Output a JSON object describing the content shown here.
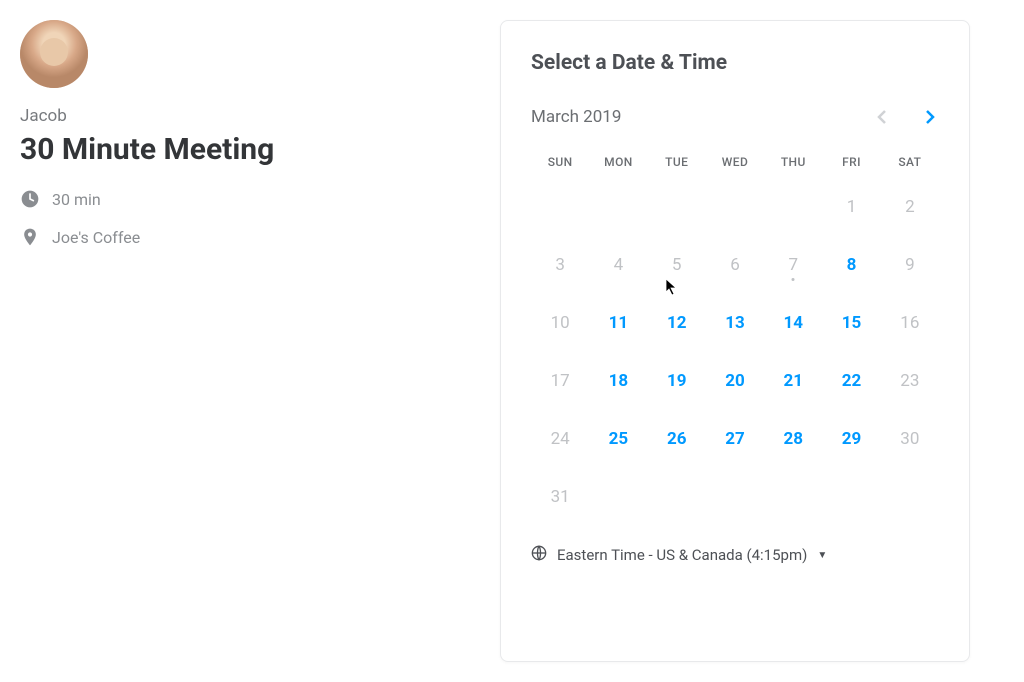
{
  "host": {
    "name": "Jacob"
  },
  "meeting": {
    "title": "30 Minute Meeting",
    "duration": "30 min",
    "location": "Joe's Coffee"
  },
  "calendar": {
    "heading": "Select a Date & Time",
    "month_label": "March 2019",
    "weekdays": [
      "SUN",
      "MON",
      "TUE",
      "WED",
      "THU",
      "FRI",
      "SAT"
    ],
    "days": [
      {
        "n": "",
        "state": "empty"
      },
      {
        "n": "",
        "state": "empty"
      },
      {
        "n": "",
        "state": "empty"
      },
      {
        "n": "",
        "state": "empty"
      },
      {
        "n": "",
        "state": "empty"
      },
      {
        "n": "1",
        "state": "disabled"
      },
      {
        "n": "2",
        "state": "disabled"
      },
      {
        "n": "3",
        "state": "disabled"
      },
      {
        "n": "4",
        "state": "disabled"
      },
      {
        "n": "5",
        "state": "disabled"
      },
      {
        "n": "6",
        "state": "disabled"
      },
      {
        "n": "7",
        "state": "disabled",
        "today": true
      },
      {
        "n": "8",
        "state": "available"
      },
      {
        "n": "9",
        "state": "disabled"
      },
      {
        "n": "10",
        "state": "disabled"
      },
      {
        "n": "11",
        "state": "available"
      },
      {
        "n": "12",
        "state": "available"
      },
      {
        "n": "13",
        "state": "available"
      },
      {
        "n": "14",
        "state": "available"
      },
      {
        "n": "15",
        "state": "available"
      },
      {
        "n": "16",
        "state": "disabled"
      },
      {
        "n": "17",
        "state": "disabled"
      },
      {
        "n": "18",
        "state": "available"
      },
      {
        "n": "19",
        "state": "available"
      },
      {
        "n": "20",
        "state": "available"
      },
      {
        "n": "21",
        "state": "available"
      },
      {
        "n": "22",
        "state": "available"
      },
      {
        "n": "23",
        "state": "disabled"
      },
      {
        "n": "24",
        "state": "disabled"
      },
      {
        "n": "25",
        "state": "available"
      },
      {
        "n": "26",
        "state": "available"
      },
      {
        "n": "27",
        "state": "available"
      },
      {
        "n": "28",
        "state": "available"
      },
      {
        "n": "29",
        "state": "available"
      },
      {
        "n": "30",
        "state": "disabled"
      },
      {
        "n": "31",
        "state": "disabled"
      }
    ],
    "timezone": "Eastern Time - US & Canada (4:15pm)"
  }
}
